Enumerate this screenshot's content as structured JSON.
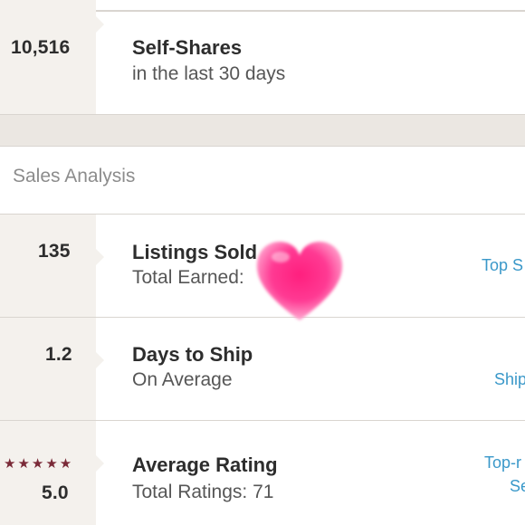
{
  "self_shares": {
    "value": "10,516",
    "title": "Self-Shares",
    "subtitle": "in the last 30 days"
  },
  "section": {
    "title": "Sales Analysis"
  },
  "listings_sold": {
    "value": "135",
    "title": "Listings Sold",
    "subtitle": "Total Earned:",
    "link": "Top S"
  },
  "days_to_ship": {
    "value": "1.2",
    "title": "Days to Ship",
    "subtitle": "On Average",
    "link": "Ship"
  },
  "average_rating": {
    "stars": "★★★★★",
    "value": "5.0",
    "title": "Average Rating",
    "subtitle": "Total Ratings: 71",
    "link_line1": "Top-r",
    "link_line2": "Se",
    "star_rating": 5
  },
  "colors": {
    "accent_link": "#3a98c9",
    "star": "#7a2a38",
    "heart": "#ff2d8a"
  }
}
